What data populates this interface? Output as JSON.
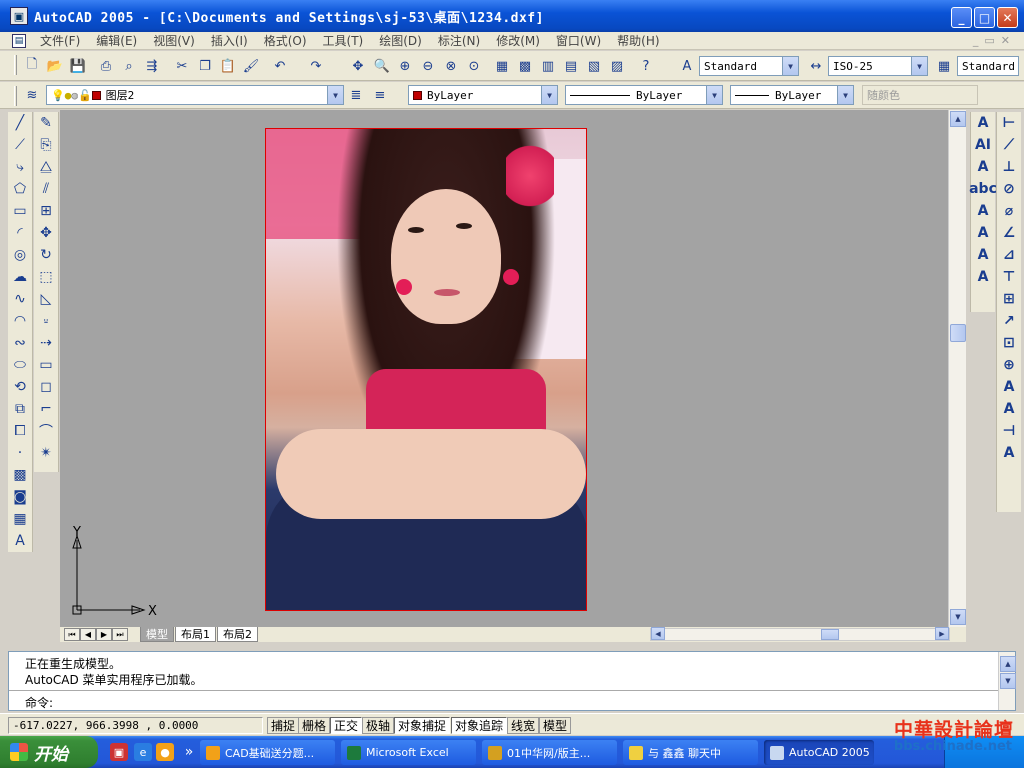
{
  "window": {
    "title": "AutoCAD 2005 - [C:\\Documents and Settings\\sj-53\\桌面\\1234.dxf]"
  },
  "menu": [
    "文件(F)",
    "编辑(E)",
    "视图(V)",
    "插入(I)",
    "格式(O)",
    "工具(T)",
    "绘图(D)",
    "标注(N)",
    "修改(M)",
    "窗口(W)",
    "帮助(H)"
  ],
  "toolbar": {
    "text_style": "Standard",
    "dim_style": "ISO-25",
    "table_style": "Standard"
  },
  "properties": {
    "layer": "图层2",
    "color": "ByLayer",
    "linetype": "ByLayer",
    "lineweight": "ByLayer",
    "plot_style": "随颜色",
    "layer_color": "#c00000"
  },
  "ucs": {
    "y_label": "Y",
    "x_label": "X"
  },
  "layout_tabs": [
    "模型",
    "布局1",
    "布局2"
  ],
  "command": {
    "line1": "正在重生成模型。",
    "line2": "AutoCAD 菜单实用程序已加载。",
    "prompt": "命令:"
  },
  "status": {
    "coords": "-617.0227, 966.3998 , 0.0000",
    "buttons": [
      "捕捉",
      "栅格",
      "正交",
      "极轴",
      "对象捕捉",
      "对象追踪",
      "线宽",
      "模型"
    ]
  },
  "watermark": {
    "title": "中華設計論壇",
    "url": "bbs.chinade.net"
  },
  "taskbar": {
    "start": "开始",
    "tasks": [
      "CAD基础送分题...",
      "Microsoft Excel",
      "01中华网/版主...",
      "与 鑫鑫 聊天中",
      "AutoCAD 2005"
    ]
  }
}
